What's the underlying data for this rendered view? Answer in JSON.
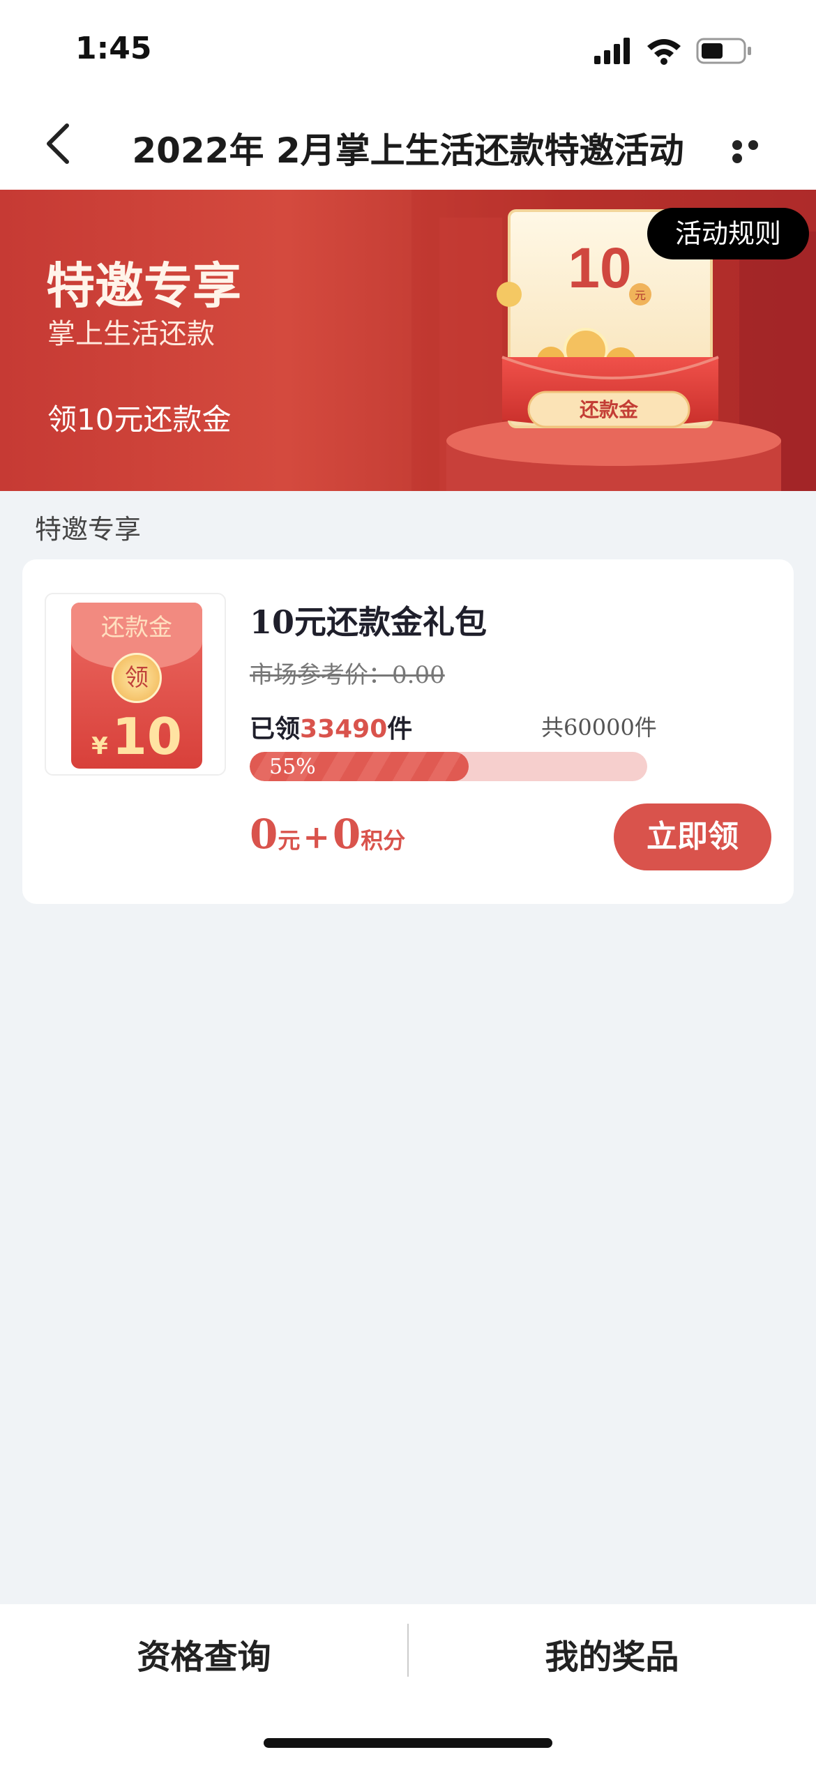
{
  "status_bar": {
    "time": "1:45"
  },
  "nav": {
    "title": "2022年 2月掌上生活还款特邀活动"
  },
  "banner": {
    "title": "特邀专享",
    "subtitle": "掌上生活还款",
    "description": "领10元还款金",
    "rules_button": "活动规则",
    "art_amount": "10",
    "art_unit": "元",
    "art_label": "还款金"
  },
  "section": {
    "label": "特邀专享"
  },
  "product": {
    "thumb_label": "还款金",
    "thumb_coin": "领",
    "thumb_currency": "¥",
    "thumb_amount": "10",
    "title": "10元还款金礼包",
    "ref_price": "市场参考价：0.00",
    "claimed_prefix": "已领",
    "claimed_count": "33490",
    "claimed_suffix": "件",
    "total": "共60000件",
    "progress_percent": 55,
    "progress_text": "55%",
    "price_cash": "0",
    "price_cash_unit": "元",
    "price_plus": "+",
    "price_points": "0",
    "price_points_unit": "积分",
    "claim_button": "立即领"
  },
  "bottom_tabs": [
    {
      "label": "资格查询"
    },
    {
      "label": "我的奖品"
    }
  ],
  "colors": {
    "accent": "#d9534c",
    "progress_track": "#f6cfcd",
    "background": "#f0f3f6"
  }
}
